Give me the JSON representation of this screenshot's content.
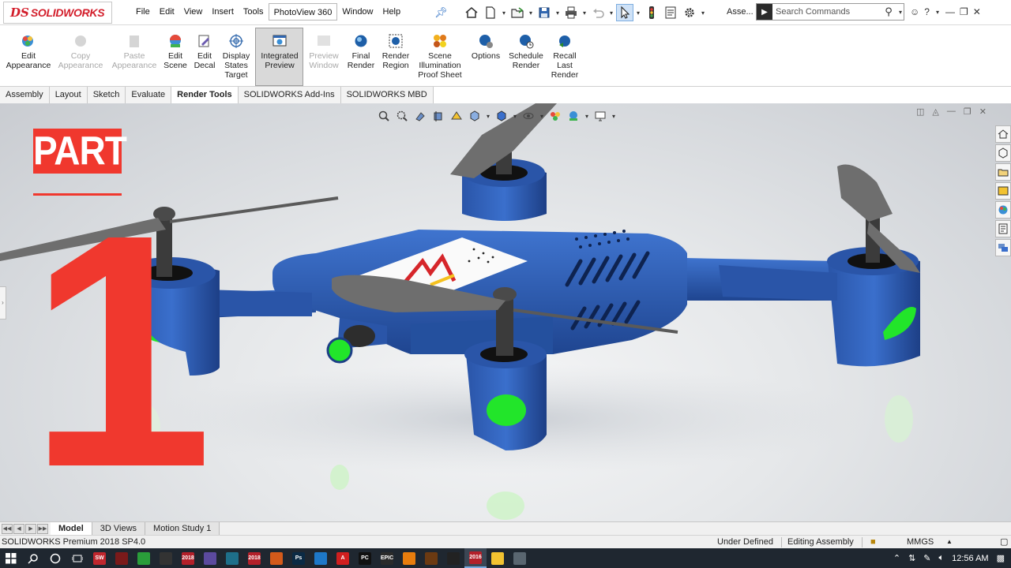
{
  "app": {
    "logo_ds": "DS",
    "logo_text": "SOLIDWORKS"
  },
  "menu": [
    "File",
    "Edit",
    "View",
    "Insert",
    "Tools",
    "PhotoView 360",
    "Window",
    "Help"
  ],
  "quick_access": {
    "assembly_label": "Asse...",
    "search_placeholder": "Search Commands"
  },
  "command_manager": [
    {
      "id": "edit-appearance",
      "label": "Edit\nAppearance",
      "enabled": true
    },
    {
      "id": "copy-appearance",
      "label": "Copy\nAppearance",
      "enabled": false
    },
    {
      "id": "paste-appearance",
      "label": "Paste\nAppearance",
      "enabled": false
    },
    {
      "id": "edit-scene",
      "label": "Edit\nScene",
      "enabled": true
    },
    {
      "id": "edit-decal",
      "label": "Edit\nDecal",
      "enabled": true
    },
    {
      "id": "display-states-target",
      "label": "Display\nStates\nTarget",
      "enabled": true
    },
    {
      "id": "integrated-preview",
      "label": "Integrated\nPreview",
      "enabled": true,
      "pressed": true
    },
    {
      "id": "preview-window",
      "label": "Preview\nWindow",
      "enabled": false
    },
    {
      "id": "final-render",
      "label": "Final\nRender",
      "enabled": true
    },
    {
      "id": "render-region",
      "label": "Render\nRegion",
      "enabled": true
    },
    {
      "id": "scene-illumination-proof-sheet",
      "label": "Scene\nIllumination\nProof Sheet",
      "enabled": true
    },
    {
      "id": "options",
      "label": "Options",
      "enabled": true
    },
    {
      "id": "schedule-render",
      "label": "Schedule\nRender",
      "enabled": true
    },
    {
      "id": "recall-last-render",
      "label": "Recall\nLast\nRender",
      "enabled": true
    }
  ],
  "tabs": [
    {
      "label": "Assembly",
      "active": false
    },
    {
      "label": "Layout",
      "active": false
    },
    {
      "label": "Sketch",
      "active": false
    },
    {
      "label": "Evaluate",
      "active": false
    },
    {
      "label": "Render Tools",
      "active": true
    },
    {
      "label": "SOLIDWORKS Add-Ins",
      "active": false
    },
    {
      "label": "SOLIDWORKS MBD",
      "active": false
    }
  ],
  "overlay": {
    "part_label": "PART",
    "part_number": "1"
  },
  "colors": {
    "drone_body": "#2f5fb8",
    "drone_body_dark": "#1f4590",
    "led_green": "#22e52a",
    "propeller": "#6b6b6b",
    "part_red": "#f0382e",
    "logo_red": "#d31e2b"
  },
  "bottom_tabs": [
    {
      "label": "Model",
      "active": true
    },
    {
      "label": "3D Views",
      "active": false
    },
    {
      "label": "Motion Study 1",
      "active": false
    }
  ],
  "status": {
    "product": "SOLIDWORKS Premium 2018 SP4.0",
    "definition": "Under Defined",
    "mode": "Editing Assembly",
    "units": "MMGS"
  },
  "taskbar": {
    "time": "12:56 AM",
    "apps": [
      {
        "icon": "app-red-icon",
        "color": "#c0262d",
        "text": "SW"
      },
      {
        "icon": "app-dark-red-icon",
        "color": "#7a1a1a",
        "text": ""
      },
      {
        "icon": "app-green-icon",
        "color": "#2a9d3a",
        "text": ""
      },
      {
        "icon": "app-inkscape-icon",
        "color": "#333333",
        "text": ""
      },
      {
        "icon": "app-sw2018-icon",
        "color": "#b3202a",
        "text": "2018"
      },
      {
        "icon": "app-purple-icon",
        "color": "#5b4a9e",
        "text": ""
      },
      {
        "icon": "app-terminal-icon",
        "color": "#1e6f8a",
        "text": ""
      },
      {
        "icon": "app-sw2018b-icon",
        "color": "#b3202a",
        "text": "2018"
      },
      {
        "icon": "app-matlab-icon",
        "color": "#d45a1a",
        "text": ""
      },
      {
        "icon": "app-photoshop-icon",
        "color": "#0b2a44",
        "text": "Ps"
      },
      {
        "icon": "app-vscode-icon",
        "color": "#1e78c8",
        "text": ""
      },
      {
        "icon": "app-acrobat-icon",
        "color": "#d01f1f",
        "text": "A"
      },
      {
        "icon": "app-pycharm-icon",
        "color": "#111111",
        "text": "PC"
      },
      {
        "icon": "app-epic-icon",
        "color": "#2b2b2b",
        "text": "EPIC"
      },
      {
        "icon": "app-blender-icon",
        "color": "#e87d0d",
        "text": ""
      },
      {
        "icon": "app-orange-icon",
        "color": "#6b3a12",
        "text": ""
      },
      {
        "icon": "app-unreal-icon",
        "color": "#222222",
        "text": ""
      },
      {
        "icon": "app-sw2016-icon",
        "color": "#b3202a",
        "text": "2016"
      },
      {
        "icon": "app-yellow-icon",
        "color": "#f2c230",
        "text": ""
      },
      {
        "icon": "app-gray-icon",
        "color": "#5a6670",
        "text": ""
      }
    ]
  }
}
